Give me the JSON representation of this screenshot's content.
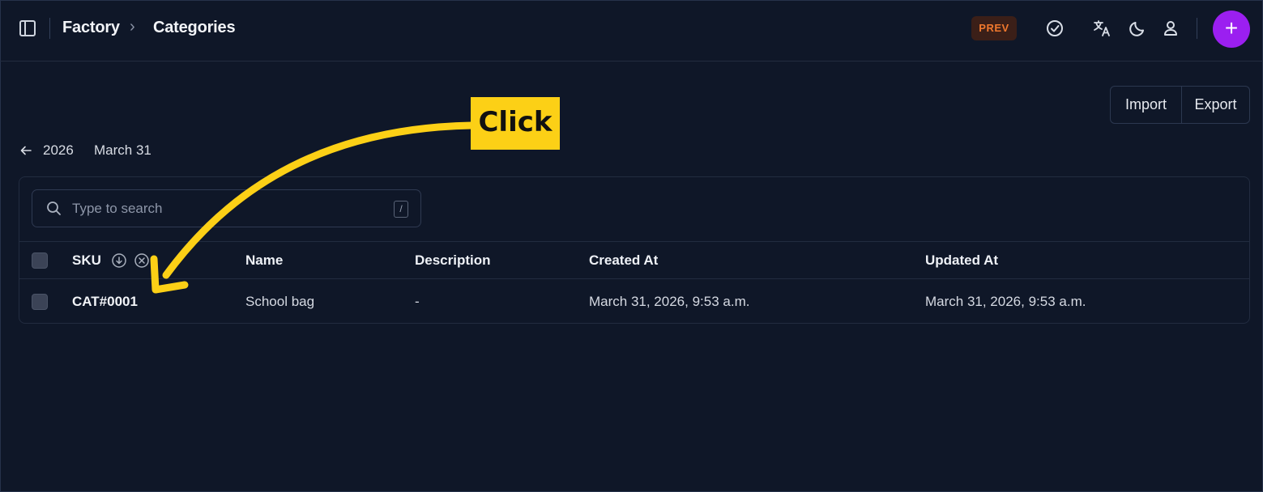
{
  "header": {
    "breadcrumb": [
      "Factory",
      "Categories"
    ],
    "badge": "PREV",
    "icons": [
      "sidebar-toggle-icon",
      "check-circle-icon",
      "translate-icon",
      "moon-icon",
      "user-icon",
      "plus-icon"
    ]
  },
  "actions": {
    "import_label": "Import",
    "export_label": "Export"
  },
  "date_nav": {
    "year": "2026",
    "day": "March 31"
  },
  "search": {
    "placeholder": "Type to search",
    "shortcut": "/"
  },
  "table": {
    "columns": [
      "SKU",
      "Name",
      "Description",
      "Created At",
      "Updated At"
    ],
    "rows": [
      {
        "sku": "CAT#0001",
        "name": "School bag",
        "description": "-",
        "created_at": "March 31, 2026, 9:53 a.m.",
        "updated_at": "March 31, 2026, 9:53 a.m."
      }
    ]
  },
  "annotation": {
    "label": "Click",
    "color": "#fcd016"
  },
  "colors": {
    "accent": "#9b1ff0",
    "badge_text": "#f0782d",
    "background": "#0f1728"
  }
}
